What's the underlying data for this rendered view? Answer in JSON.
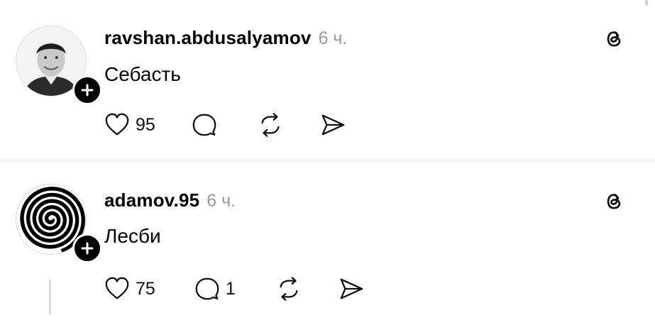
{
  "posts": [
    {
      "username": "ravshan.abdusalyamov",
      "time": "6 ч.",
      "text": "Себасть",
      "likes": "95",
      "replies": "",
      "avatar_icon": "profile-photo-icon"
    },
    {
      "username": "adamov.95",
      "time": "6 ч.",
      "text": "Лесби",
      "likes": "75",
      "replies": "1",
      "avatar_icon": "spiral-icon"
    }
  ],
  "icons": {
    "like": "heart-icon",
    "reply": "comment-icon",
    "repost": "repost-icon",
    "share": "send-icon",
    "app": "threads-icon",
    "follow": "plus-icon"
  }
}
